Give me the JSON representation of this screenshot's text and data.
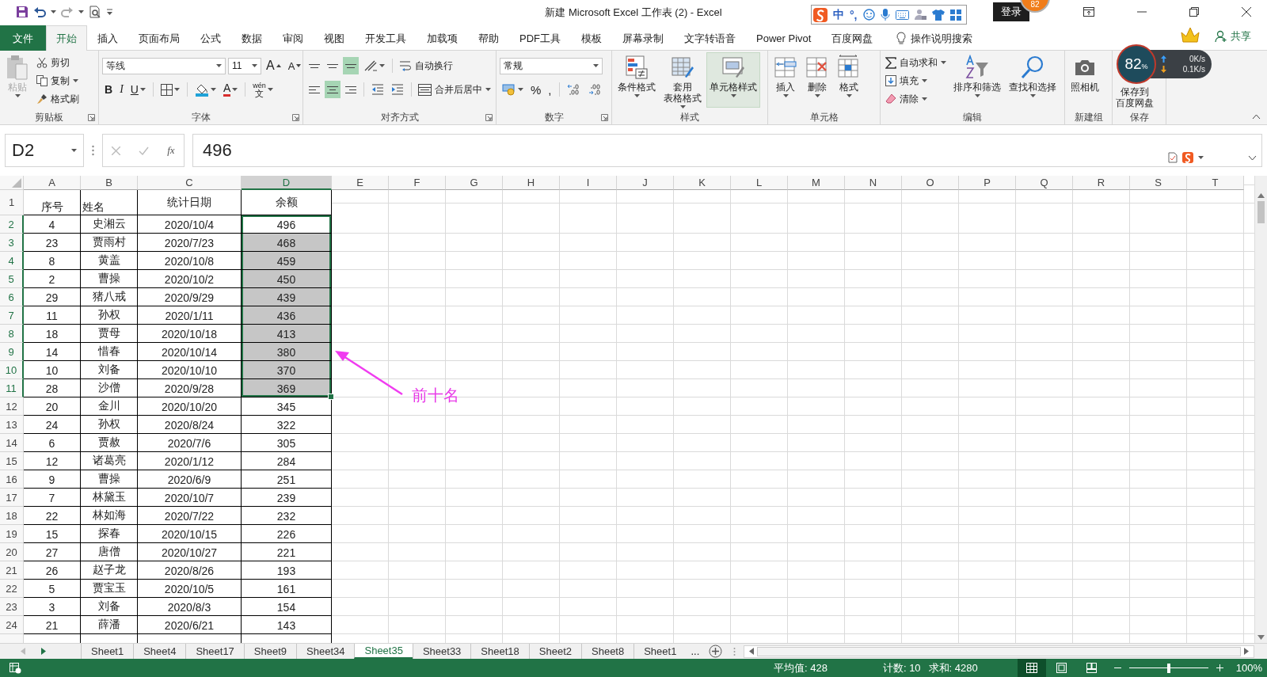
{
  "window": {
    "title": "新建 Microsoft Excel 工作表 (2) - Excel",
    "badge": "82",
    "sign_in": "登录"
  },
  "ime_toolbar": {
    "mode": "中",
    "punctuation": "°,"
  },
  "menu_tabs": [
    {
      "kind": "file",
      "label": "文件",
      "selected": false
    },
    {
      "kind": "tab",
      "label": "开始",
      "selected": true
    },
    {
      "kind": "tab",
      "label": "插入",
      "selected": false
    },
    {
      "kind": "tab",
      "label": "页面布局",
      "selected": false
    },
    {
      "kind": "tab",
      "label": "公式",
      "selected": false
    },
    {
      "kind": "tab",
      "label": "数据",
      "selected": false
    },
    {
      "kind": "tab",
      "label": "审阅",
      "selected": false
    },
    {
      "kind": "tab",
      "label": "视图",
      "selected": false
    },
    {
      "kind": "tab",
      "label": "开发工具",
      "selected": false
    },
    {
      "kind": "tab",
      "label": "加载项",
      "selected": false
    },
    {
      "kind": "tab",
      "label": "帮助",
      "selected": false
    },
    {
      "kind": "tab",
      "label": "PDF工具",
      "selected": false
    },
    {
      "kind": "tab",
      "label": "模板",
      "selected": false
    },
    {
      "kind": "tab",
      "label": "屏幕录制",
      "selected": false
    },
    {
      "kind": "tab",
      "label": "文字转语音",
      "selected": false
    },
    {
      "kind": "tab",
      "label": "Power Pivot",
      "selected": false
    },
    {
      "kind": "tab",
      "label": "百度网盘",
      "selected": false
    },
    {
      "kind": "search",
      "label": "操作说明搜索",
      "selected": false
    }
  ],
  "share": "共享",
  "ribbon": {
    "clipboard": {
      "label": "剪贴板",
      "paste": "粘贴",
      "paste_disabled": true,
      "cut": "剪切",
      "copy": "复制",
      "format_painter": "格式刷"
    },
    "font": {
      "label": "字体",
      "font_name": "等线",
      "font_size": "11",
      "grow": "A",
      "shrink": "A",
      "bold": "B",
      "italic": "I",
      "underline": "U",
      "font_color": "A",
      "phonetic_top": "wén",
      "phonetic_bottom": "文"
    },
    "alignment": {
      "label": "对齐方式",
      "vertical": [
        {
          "selected": false
        },
        {
          "selected": false
        },
        {
          "selected": true
        }
      ],
      "horizontal": [
        {
          "selected": false
        },
        {
          "selected": true
        },
        {
          "selected": false
        }
      ],
      "wrap_text": "自动换行",
      "merge_center": "合并后居中"
    },
    "number": {
      "label": "数字",
      "format": "常规",
      "percent": "%",
      "comma": ","
    },
    "styles": {
      "label": "样式",
      "buttons": [
        {
          "lines": [
            "条件格式"
          ],
          "highlighted": false
        },
        {
          "lines": [
            "套用",
            "表格格式"
          ],
          "highlighted": false
        },
        {
          "lines": [
            "单元格样式"
          ],
          "highlighted": true
        }
      ]
    },
    "cells": {
      "label": "单元格",
      "buttons": [
        "插入",
        "删除",
        "格式"
      ]
    },
    "editing": {
      "label": "编辑",
      "autosum": "自动求和",
      "fill": "填充",
      "clear": "清除",
      "sort_filter": "排序和筛选",
      "find_select": "查找和选择"
    },
    "new_group": {
      "label": "新建组",
      "camera": "照相机"
    },
    "save": {
      "label": "保存",
      "save_cloud": [
        "保存到",
        "百度网盘"
      ]
    }
  },
  "network_monitor": {
    "percent": "82",
    "unit": "%",
    "upload": "0K/s",
    "download": "0.1K/s"
  },
  "formula_bar": {
    "name_box": "D2",
    "function_label": "fx",
    "value": "496"
  },
  "sheet": {
    "columns": [
      {
        "label": "A",
        "selected": false
      },
      {
        "label": "B",
        "selected": false
      },
      {
        "label": "C",
        "selected": false
      },
      {
        "label": "D",
        "selected": true
      },
      {
        "label": "E",
        "selected": false
      },
      {
        "label": "F",
        "selected": false
      },
      {
        "label": "G",
        "selected": false
      },
      {
        "label": "H",
        "selected": false
      },
      {
        "label": "I",
        "selected": false
      },
      {
        "label": "J",
        "selected": false
      },
      {
        "label": "K",
        "selected": false
      },
      {
        "label": "L",
        "selected": false
      },
      {
        "label": "M",
        "selected": false
      },
      {
        "label": "N",
        "selected": false
      },
      {
        "label": "O",
        "selected": false
      },
      {
        "label": "P",
        "selected": false
      },
      {
        "label": "Q",
        "selected": false
      },
      {
        "label": "R",
        "selected": false
      },
      {
        "label": "S",
        "selected": false
      },
      {
        "label": "T",
        "selected": false
      }
    ],
    "header": {
      "number": "1",
      "cells": [
        "序号",
        "姓名",
        "统计日期",
        "余额"
      ]
    },
    "rows": [
      {
        "number": "2",
        "cells": [
          "4",
          "史湘云",
          "2020/10/4",
          "496"
        ],
        "selected": true,
        "active": true
      },
      {
        "number": "3",
        "cells": [
          "23",
          "贾雨村",
          "2020/7/23",
          "468"
        ],
        "selected": true,
        "active": false
      },
      {
        "number": "4",
        "cells": [
          "8",
          "黄盖",
          "2020/10/8",
          "459"
        ],
        "selected": true,
        "active": false
      },
      {
        "number": "5",
        "cells": [
          "2",
          "曹操",
          "2020/10/2",
          "450"
        ],
        "selected": true,
        "active": false
      },
      {
        "number": "6",
        "cells": [
          "29",
          "猪八戒",
          "2020/9/29",
          "439"
        ],
        "selected": true,
        "active": false
      },
      {
        "number": "7",
        "cells": [
          "11",
          "孙权",
          "2020/1/11",
          "436"
        ],
        "selected": true,
        "active": false
      },
      {
        "number": "8",
        "cells": [
          "18",
          "贾母",
          "2020/10/18",
          "413"
        ],
        "selected": true,
        "active": false
      },
      {
        "number": "9",
        "cells": [
          "14",
          "惜春",
          "2020/10/14",
          "380"
        ],
        "selected": true,
        "active": false
      },
      {
        "number": "10",
        "cells": [
          "10",
          "刘备",
          "2020/10/10",
          "370"
        ],
        "selected": true,
        "active": false
      },
      {
        "number": "11",
        "cells": [
          "28",
          "沙僧",
          "2020/9/28",
          "369"
        ],
        "selected": true,
        "active": false
      },
      {
        "number": "12",
        "cells": [
          "20",
          "金川",
          "2020/10/20",
          "345"
        ],
        "selected": false,
        "active": false
      },
      {
        "number": "13",
        "cells": [
          "24",
          "孙权",
          "2020/8/24",
          "322"
        ],
        "selected": false,
        "active": false
      },
      {
        "number": "14",
        "cells": [
          "6",
          "贾赦",
          "2020/7/6",
          "305"
        ],
        "selected": false,
        "active": false
      },
      {
        "number": "15",
        "cells": [
          "12",
          "诸葛亮",
          "2020/1/12",
          "284"
        ],
        "selected": false,
        "active": false
      },
      {
        "number": "16",
        "cells": [
          "9",
          "曹操",
          "2020/6/9",
          "251"
        ],
        "selected": false,
        "active": false
      },
      {
        "number": "17",
        "cells": [
          "7",
          "林黛玉",
          "2020/10/7",
          "239"
        ],
        "selected": false,
        "active": false
      },
      {
        "number": "18",
        "cells": [
          "22",
          "林如海",
          "2020/7/22",
          "232"
        ],
        "selected": false,
        "active": false
      },
      {
        "number": "19",
        "cells": [
          "15",
          "探春",
          "2020/10/15",
          "226"
        ],
        "selected": false,
        "active": false
      },
      {
        "number": "20",
        "cells": [
          "27",
          "唐僧",
          "2020/10/27",
          "221"
        ],
        "selected": false,
        "active": false
      },
      {
        "number": "21",
        "cells": [
          "26",
          "赵子龙",
          "2020/8/26",
          "193"
        ],
        "selected": false,
        "active": false
      },
      {
        "number": "22",
        "cells": [
          "5",
          "贾宝玉",
          "2020/10/5",
          "161"
        ],
        "selected": false,
        "active": false
      },
      {
        "number": "23",
        "cells": [
          "3",
          "刘备",
          "2020/8/3",
          "154"
        ],
        "selected": false,
        "active": false
      },
      {
        "number": "24",
        "cells": [
          "21",
          "薛潘",
          "2020/6/21",
          "143"
        ],
        "selected": false,
        "active": false
      }
    ]
  },
  "annotation": {
    "text": "前十名"
  },
  "sheet_tabs": [
    {
      "label": "Sheet1",
      "selected": false
    },
    {
      "label": "Sheet4",
      "selected": false
    },
    {
      "label": "Sheet17",
      "selected": false
    },
    {
      "label": "Sheet9",
      "selected": false
    },
    {
      "label": "Sheet34",
      "selected": false
    },
    {
      "label": "Sheet35",
      "selected": true
    },
    {
      "label": "Sheet33",
      "selected": false
    },
    {
      "label": "Sheet18",
      "selected": false
    },
    {
      "label": "Sheet2",
      "selected": false
    },
    {
      "label": "Sheet8",
      "selected": false
    },
    {
      "label": "Sheet1",
      "selected": false
    }
  ],
  "more_tabs": "...",
  "status_bar": {
    "average": "平均值: 428",
    "count": "计数: 10",
    "sum": "求和: 4280",
    "views": [
      {
        "selected": true
      },
      {
        "selected": false
      },
      {
        "selected": false
      }
    ],
    "zoom_slider": {
      "level": 0.5
    },
    "zoom": "100%"
  }
}
